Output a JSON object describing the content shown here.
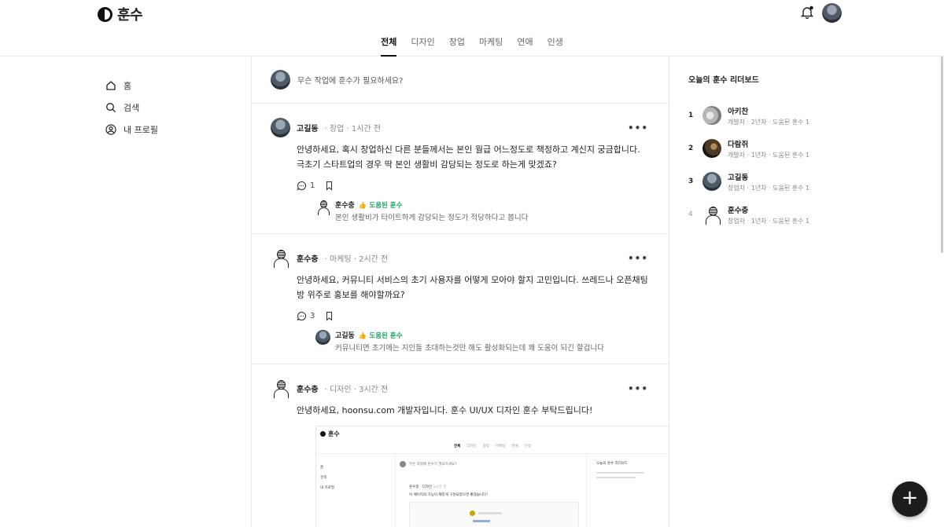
{
  "app": {
    "title": "훈수"
  },
  "tabs": [
    {
      "label": "전체",
      "active": true
    },
    {
      "label": "디자인"
    },
    {
      "label": "창업"
    },
    {
      "label": "마케팅"
    },
    {
      "label": "연애"
    },
    {
      "label": "인생"
    }
  ],
  "nav": [
    {
      "label": "홈",
      "icon": "home-icon"
    },
    {
      "label": "검색",
      "icon": "search-icon"
    },
    {
      "label": "내 프로필",
      "icon": "profile-icon"
    }
  ],
  "compose": {
    "placeholder": "무슨 작업에 훈수가 필요하세요?"
  },
  "posts": [
    {
      "author": "고길동",
      "meta": "· 창업 · 1시간 전",
      "body": "안녕하세요, 혹시 창업하신 다른 분들께서는 본인 월급 어느정도로 책정하고 계신지 궁금합니다. 극초기 스타트업의 경우 딱 본인 생활비 감당되는 정도로 하는게 맞겠죠?",
      "comments": "1",
      "reply": {
        "author": "훈수충",
        "badge": "👍 도움된 훈수",
        "body": "본인 생활비가 타이트하게 감당되는 정도가 적당하다고 봅니다"
      }
    },
    {
      "author": "훈수충",
      "meta": "· 마케팅 · 2시간 전",
      "body": "안녕하세요, 커뮤니티 서비스의 초기 사용자를 어떻게 모아야 할지 고민입니다. 쓰레드나 오픈채팅방 위주로 홍보를 해야할까요?",
      "comments": "3",
      "reply": {
        "author": "고길동",
        "badge": "👍 도움된 훈수",
        "body": "커뮤니티면 초기에는 지인들 초대하는것만 해도 활성화되는데 꽤 도움이 되긴 할겁니다"
      }
    },
    {
      "author": "훈수충",
      "meta": "· 디자인 · 3시간 전",
      "body": "안녕하세요, hoonsu.com 개발자입니다. 훈수 UI/UX 디자인 훈수 부탁드립니다!",
      "image": {
        "logo": "훈수",
        "tabs": [
          "전체",
          "디자인",
          "창업",
          "마케팅",
          "연애",
          "인생"
        ],
        "nav": [
          "홈",
          "검색",
          "내 프로필"
        ],
        "compose": "무슨 작업에 훈수가 필요하세요?",
        "leader_title": "오늘의 훈수 리더보드",
        "post_author": "훈수충 · 디자인",
        "post_time": "1시간 전",
        "post_body": "이 페이지의 기능이 재밌게 구현되었으면 좋겠습니다!"
      }
    }
  ],
  "leaderboard": {
    "title": "오늘의 훈수 리더보드",
    "entries": [
      {
        "rank": "1",
        "name": "아키찬",
        "sub": "개발자 · 2년차 · 도움된 훈수 1"
      },
      {
        "rank": "2",
        "name": "다람쥐",
        "sub": "개발자 · 1년차 · 도움된 훈수 1"
      },
      {
        "rank": "3",
        "name": "고길동",
        "sub": "창업자 · 1년차 · 도움된 훈수 1"
      },
      {
        "rank": "4",
        "name": "훈수충",
        "sub": "창업자 · 1년차 · 도움된 훈수 1"
      }
    ]
  },
  "fab": {
    "label": "+"
  }
}
